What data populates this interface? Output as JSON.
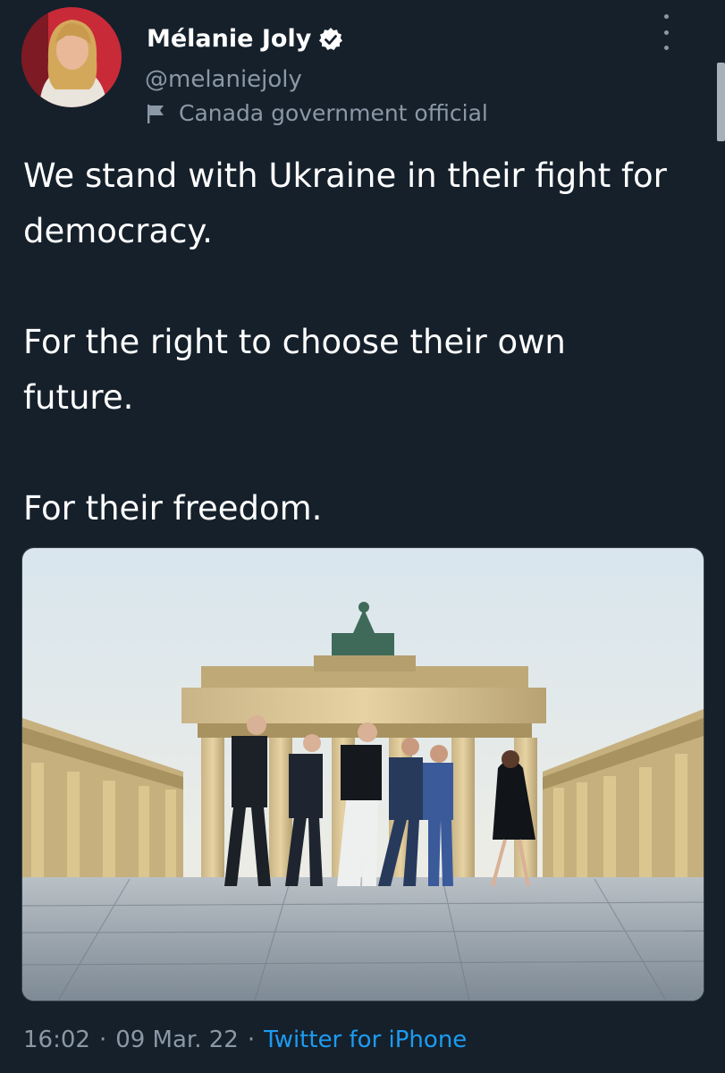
{
  "author": {
    "name": "Mélanie Joly",
    "handle": "@melaniejoly",
    "label": "Canada government official",
    "verified": true
  },
  "tweet": {
    "paragraphs": [
      "We stand with Ukraine in their fight for democracy.",
      "For the right to choose their own future.",
      "For their freedom."
    ]
  },
  "meta": {
    "time": "16:02",
    "separator": "·",
    "date": "09 Mar. 22",
    "source": "Twitter for iPhone"
  },
  "theme": {
    "background": "#15202b",
    "secondary_text": "#8b98a5",
    "link": "#1d9bf0",
    "verified_badge": "#ffffff"
  },
  "icons": {
    "verified": "verified-badge-icon",
    "label": "flag-icon",
    "more": "more-vertical-icon"
  }
}
